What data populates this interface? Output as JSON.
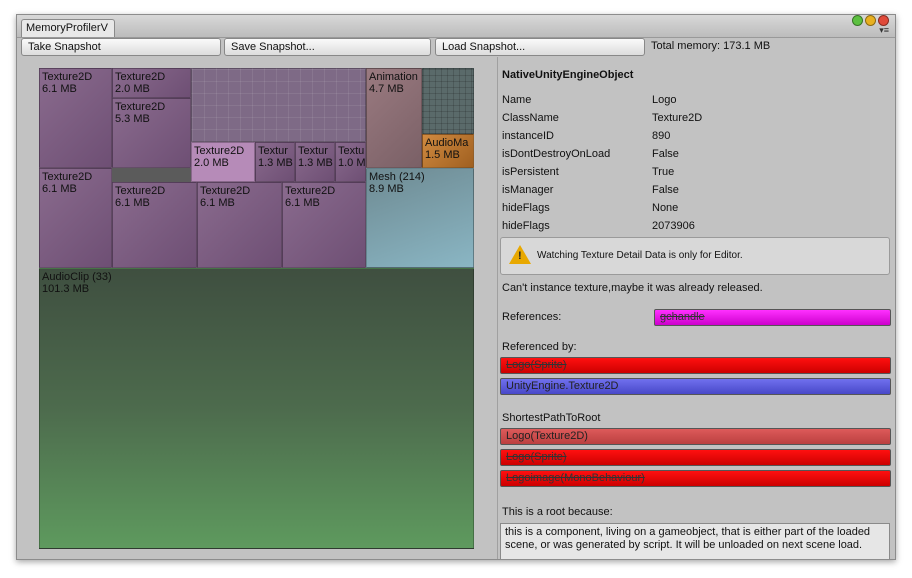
{
  "window": {
    "tab_title": "MemoryProfilerV",
    "colors": {
      "close": "#e04a3a",
      "minimize": "#e8b020",
      "zoom": "#5cc040"
    }
  },
  "toolbar": {
    "take_snapshot": "Take Snapshot",
    "save_snapshot": "Save Snapshot...",
    "load_snapshot": "Load Snapshot...",
    "total_memory": "Total memory: 173.1 MB"
  },
  "treemap": {
    "cells": [
      {
        "name": "Texture2D",
        "size": "6.1 MB"
      },
      {
        "name": "Texture2D",
        "size": "2.0 MB"
      },
      {
        "name": "Texture2D",
        "size": "5.3 MB"
      },
      {
        "name": "Texture2D",
        "size": "2.0 MB"
      },
      {
        "name": "Textur",
        "size": "1.3 MB"
      },
      {
        "name": "Textur",
        "size": "1.3 MB"
      },
      {
        "name": "Textu",
        "size": "1.0 M"
      },
      {
        "name": "Animation",
        "size": "4.7 MB"
      },
      {
        "name": "AudioMa",
        "size": "1.5 MB"
      },
      {
        "name": "Texture2D",
        "size": "6.1 MB"
      },
      {
        "name": "Texture2D",
        "size": "6.1 MB"
      },
      {
        "name": "Texture2D",
        "size": "6.1 MB"
      },
      {
        "name": "Texture2D",
        "size": "6.1 MB"
      },
      {
        "name": "Mesh (214)",
        "size": "8.9 MB"
      },
      {
        "name": "AudioClip (33)",
        "size": "101.3 MB"
      }
    ]
  },
  "inspector": {
    "title": "NativeUnityEngineObject",
    "properties": [
      {
        "key": "Name",
        "value": "Logo"
      },
      {
        "key": "ClassName",
        "value": "Texture2D"
      },
      {
        "key": "instanceID",
        "value": "890"
      },
      {
        "key": "isDontDestroyOnLoad",
        "value": "False"
      },
      {
        "key": "isPersistent",
        "value": "True"
      },
      {
        "key": "isManager",
        "value": "False"
      },
      {
        "key": "hideFlags",
        "value": "None"
      },
      {
        "key": "hideFlags",
        "value": "2073906"
      }
    ],
    "warning": "Watching Texture Detail Data is only for Editor.",
    "warning_icon": "warning-icon",
    "cant_instance": "Can't instance texture,maybe it was already released.",
    "references_label": "References:",
    "references": [
      "gchandle"
    ],
    "referenced_by_label": "Referenced by:",
    "referenced_by": [
      "Logo(Sprite)",
      "UnityEngine.Texture2D"
    ],
    "shortest_path_label": "ShortestPathToRoot",
    "shortest_path": [
      "Logo(Texture2D)",
      "Logo(Sprite)",
      "Logoimage(MonoBehaviour)"
    ],
    "root_label": "This is a root because:",
    "root_reason": "this is a component, living on a gameobject, that is either part of the loaded scene, or was generated by script. It will be unloaded on next scene load."
  }
}
